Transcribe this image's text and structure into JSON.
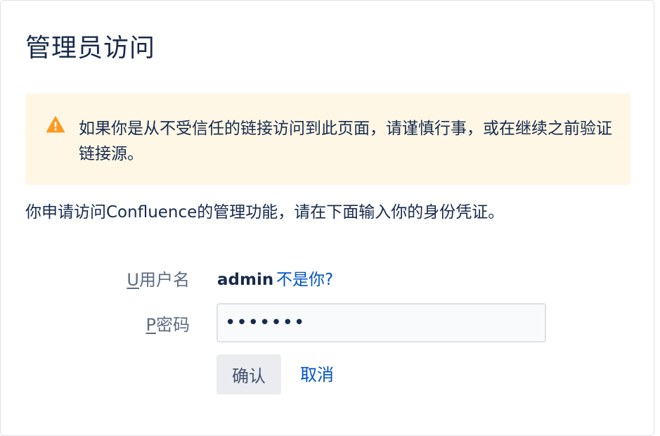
{
  "dialog": {
    "title": "管理员访问"
  },
  "warning": {
    "icon": "warning-icon",
    "color": "#ff991f",
    "background": "#fff7e6",
    "message": "如果你是从不受信任的链接访问到此页面，请谨慎行事，或在继续之前验证链接源。"
  },
  "intro": {
    "text": "你申请访问Confluence的管理功能，请在下面输入你的身份凭证。"
  },
  "form": {
    "username": {
      "accesskey": "U",
      "label": "用户名",
      "value": "admin",
      "not_you_link": "不是你?"
    },
    "password": {
      "accesskey": "P",
      "label": "密码",
      "value": "•••••••"
    },
    "confirm_label": "确认",
    "cancel_label": "取消"
  },
  "colors": {
    "text": "#172b4d",
    "label": "#5e6c84",
    "link": "#0052cc",
    "button_bg": "#ebecf0"
  }
}
